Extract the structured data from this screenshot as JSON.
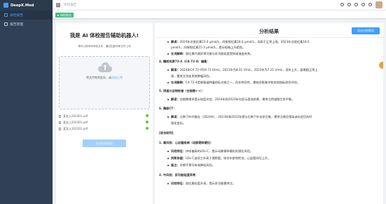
{
  "app": {
    "name": "DeepX.Med"
  },
  "sidebar": {
    "items": [
      {
        "label": "体检报告",
        "active": true
      },
      {
        "label": "报告管理",
        "active": false
      }
    ]
  },
  "header": {
    "breadcrumb": "体检报告"
  },
  "tags": {
    "active": "体检报告"
  },
  "left": {
    "title": "我是 AI 体检报告辅助机器人!",
    "subtitle": "请可以将你的体检文件，通过如此时和文件上传",
    "upload_text": "将文件拖到此处，或",
    "upload_link": "点击上传",
    "files": [
      "某女士202401.pdf",
      "某女士202301.pdf",
      "某女士202201.pdf"
    ],
    "button": "生成分析报告"
  },
  "right": {
    "title": "分析结果",
    "button": "导出分析报告",
    "lines": [
      {
        "indent": 12,
        "bullet": true,
        "label": "解读：",
        "text": "2024年总胆红素23.4 μmol/L，间接胆红素18.0 μmol/L，均高于正常上限。2023年总胆红素18.5"
      },
      {
        "indent": 12,
        "bullet": false,
        "label": "",
        "text": "μmol/L，间接胆红素15.3 μmol/L，提示轻微上升趋势。"
      },
      {
        "indent": 12,
        "bullet": true,
        "label": "名词解释：",
        "text": "胆红素代谢异常可能与肝功能轻度受损或溶血有关。"
      },
      {
        "indent": 0,
        "bullet": false,
        "head": true,
        "label": "",
        "text": "4. 糖类抗原72-4（CA 72-4）偏高："
      },
      {
        "indent": 12,
        "bullet": true,
        "label": "解读：",
        "text": "2024年CA 72-4为9.71 U/mL，2023年为8.01 U/mL，2022年为7.21 U/mL，逐年上升，虽略超正常上"
      },
      {
        "indent": 12,
        "bullet": false,
        "label": "",
        "text": "限，需关注消化系统肿瘤风险。"
      },
      {
        "indent": 12,
        "bullet": true,
        "label": "名词解释：",
        "text": "CA 72-4是胃肠道肿瘤的标志物之一，但非特异性，需结合影像学和其他指标综合评估。"
      },
      {
        "indent": 0,
        "bullet": false,
        "head": true,
        "label": "",
        "text": "5. 阴道分泌物检查（白细胞++）："
      },
      {
        "indent": 12,
        "bullet": true,
        "label": "解读：",
        "text": "白细胞增多提示轻度炎症，2024年和2023年均显示类似结果，需关注阴道微生态平衡。"
      },
      {
        "indent": 0,
        "bullet": false,
        "head": true,
        "label": "",
        "text": "6. 胸部CT："
      },
      {
        "indent": 12,
        "bullet": true,
        "label": "解读：",
        "text": "左肺下叶纤维灶（2024年），2023年和2022年提示左肺下叶炎症可能，需关注既往感染或炎症后的纤"
      },
      {
        "indent": 12,
        "bullet": false,
        "label": "",
        "text": "维化变化。"
      },
      {
        "indent": 0,
        "bullet": false,
        "head": true,
        "label": "",
        "text": "[综合研判]"
      },
      {
        "indent": 0,
        "bullet": false,
        "head": true,
        "label": "",
        "text": "1. 高风险：心血管疾病（动脉粥样硬化）"
      },
      {
        "indent": 12,
        "bullet": true,
        "label": "风险特征：",
        "text": "持续偏高的LDL-C，提示动脉粥样硬化的潜在风险。"
      },
      {
        "indent": 12,
        "bullet": true,
        "label": "判断依据：",
        "text": "LDL-C连续三年高于理想值，结合年龄和性别，心血管风险上升。"
      },
      {
        "indent": 12,
        "bullet": true,
        "label": "备注：",
        "text": "早期干预可有效降低风险。"
      },
      {
        "indent": 0,
        "bullet": false,
        "head": true,
        "label": "",
        "text": "2. 中风险：肝功能轻度异常"
      },
      {
        "indent": 12,
        "bullet": true,
        "label": "风险特征：",
        "text": "胆红素轻度升高，提示肝功能需关注。"
      }
    ]
  }
}
